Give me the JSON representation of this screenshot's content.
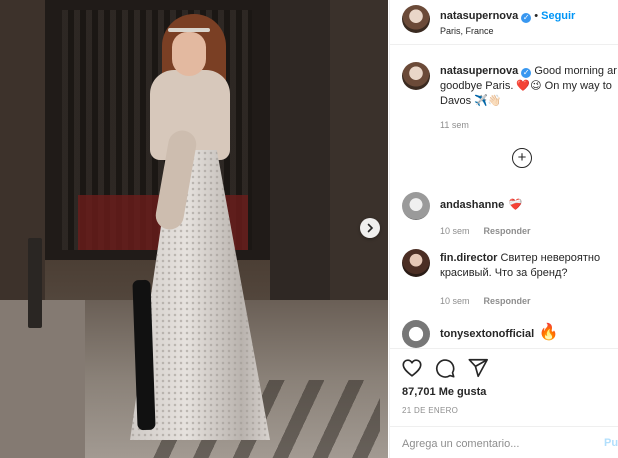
{
  "post": {
    "author": "natasupernova",
    "follow_label": "Seguir",
    "location": "Paris, France",
    "caption_line1": "Good morning ar",
    "caption_line2": "goodbye Paris. ❤️😉 On my way to",
    "caption_line3": "Davos ✈️👋🏻",
    "caption_time": "11 sem",
    "likes": "87,701 Me gusta",
    "date": "21 DE ENERO"
  },
  "comments": [
    {
      "user": "andashanne",
      "text": "❤️‍🩹",
      "time": "10 sem",
      "reply_label": "Responder"
    },
    {
      "user": "fin.director",
      "text_line1": "Свитер невероятно",
      "text_line2": "красивый. Что за бренд?",
      "time": "10 sem",
      "reply_label": "Responder"
    },
    {
      "user": "tonysextonofficial",
      "text": "🔥"
    }
  ],
  "comment_box": {
    "placeholder": "Agrega un comentario...",
    "publish_label": "Pub"
  },
  "colors": {
    "accent": "#0095f6",
    "verified": "#3897f0",
    "like_red": "#ed4956",
    "muted": "#8e8e8e"
  },
  "icons": {
    "next": "chevron-right-icon",
    "load_more": "plus-circle-icon",
    "like": "heart-icon",
    "comment": "comment-bubble-icon",
    "share": "paper-plane-icon"
  }
}
